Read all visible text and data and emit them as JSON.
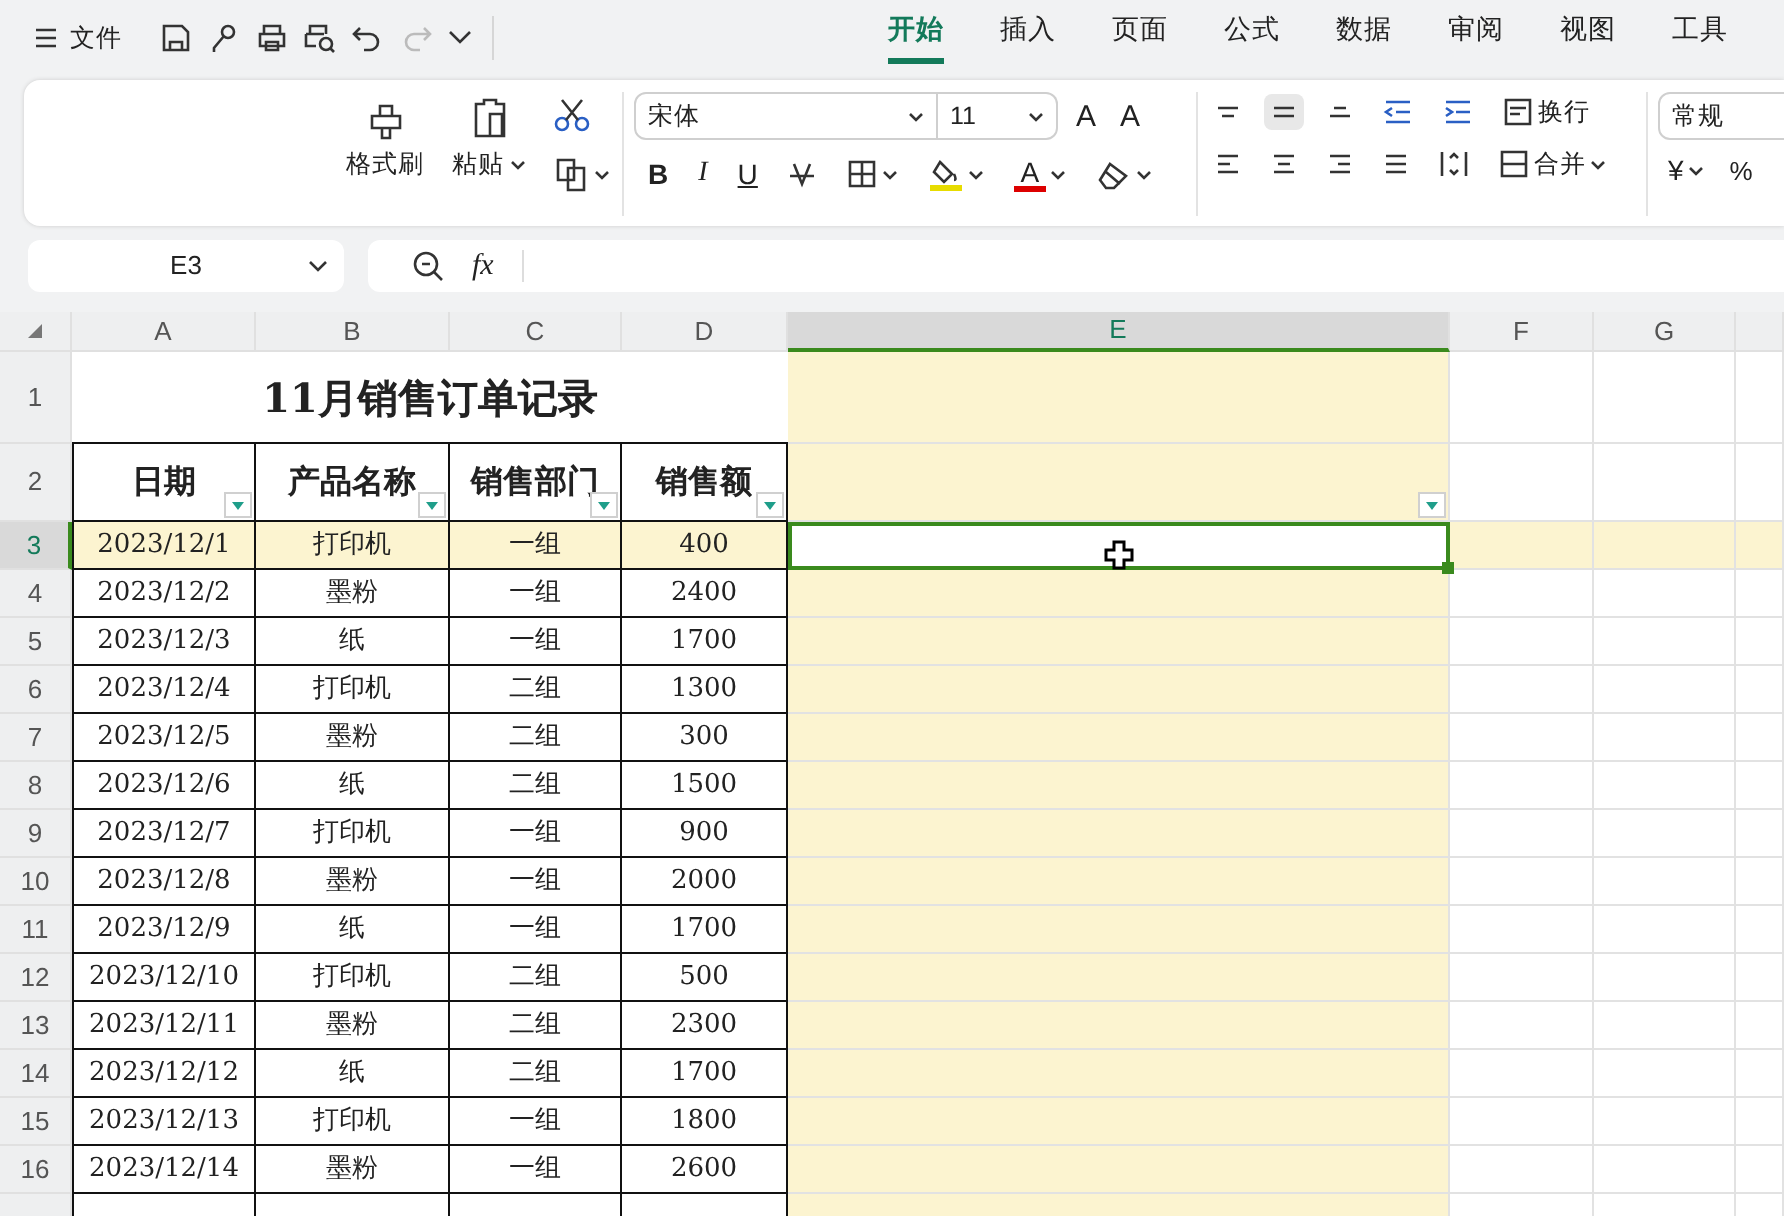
{
  "menu_bar": {
    "file_label": "文件",
    "tabs": [
      {
        "label": "开始",
        "selected": true
      },
      {
        "label": "插入",
        "selected": false
      },
      {
        "label": "页面",
        "selected": false
      },
      {
        "label": "公式",
        "selected": false
      },
      {
        "label": "数据",
        "selected": false
      },
      {
        "label": "审阅",
        "selected": false
      },
      {
        "label": "视图",
        "selected": false
      },
      {
        "label": "工具",
        "selected": false
      }
    ]
  },
  "ribbon": {
    "format_painter": "格式刷",
    "paste": "粘贴",
    "font": "宋体",
    "font_size": "11",
    "grow_font": "A",
    "shrink_font": "A",
    "bold": "B",
    "italic": "I",
    "underline": "U",
    "font_color": "A",
    "vertical_align": [
      {
        "selected": false
      },
      {
        "selected": true
      },
      {
        "selected": false
      }
    ],
    "horizontal_align": [
      {
        "selected": false
      },
      {
        "selected": false
      },
      {
        "selected": false
      },
      {
        "selected": false
      }
    ],
    "wrap": "换行",
    "merge": "合并",
    "number_format": "常规",
    "currency": "¥",
    "percent": "%"
  },
  "formula_bar": {
    "cell_ref": "E3",
    "function_label": "fx"
  },
  "sheet": {
    "columns": [
      {
        "label": "A",
        "selected": false
      },
      {
        "label": "B",
        "selected": false
      },
      {
        "label": "C",
        "selected": false
      },
      {
        "label": "D",
        "selected": false
      },
      {
        "label": "E",
        "selected": true
      },
      {
        "label": "F",
        "selected": false
      },
      {
        "label": "G",
        "selected": false
      }
    ],
    "rows": [
      {
        "label": "1",
        "selected": false
      },
      {
        "label": "2",
        "selected": false
      },
      {
        "label": "3",
        "selected": true
      },
      {
        "label": "4",
        "selected": false
      },
      {
        "label": "5",
        "selected": false
      },
      {
        "label": "6",
        "selected": false
      },
      {
        "label": "7",
        "selected": false
      },
      {
        "label": "8",
        "selected": false
      },
      {
        "label": "9",
        "selected": false
      },
      {
        "label": "10",
        "selected": false
      },
      {
        "label": "11",
        "selected": false
      },
      {
        "label": "12",
        "selected": false
      },
      {
        "label": "13",
        "selected": false
      },
      {
        "label": "14",
        "selected": false
      },
      {
        "label": "15",
        "selected": false
      },
      {
        "label": "16",
        "selected": false
      }
    ],
    "title": "11月销售订单记录",
    "headers": [
      "日期",
      "产品名称",
      "销售部门",
      "销售额"
    ],
    "records": [
      [
        "2023/12/1",
        "打印机",
        "一组",
        "400"
      ],
      [
        "2023/12/2",
        "墨粉",
        "一组",
        "2400"
      ],
      [
        "2023/12/3",
        "纸",
        "一组",
        "1700"
      ],
      [
        "2023/12/4",
        "打印机",
        "二组",
        "1300"
      ],
      [
        "2023/12/5",
        "墨粉",
        "二组",
        "300"
      ],
      [
        "2023/12/6",
        "纸",
        "二组",
        "1500"
      ],
      [
        "2023/12/7",
        "打印机",
        "一组",
        "900"
      ],
      [
        "2023/12/8",
        "墨粉",
        "一组",
        "2000"
      ],
      [
        "2023/12/9",
        "纸",
        "一组",
        "1700"
      ],
      [
        "2023/12/10",
        "打印机",
        "二组",
        "500"
      ],
      [
        "2023/12/11",
        "墨粉",
        "二组",
        "2300"
      ],
      [
        "2023/12/12",
        "纸",
        "二组",
        "1700"
      ],
      [
        "2023/12/13",
        "打印机",
        "一组",
        "1800"
      ],
      [
        "2023/12/14",
        "墨粉",
        "一组",
        "2600"
      ]
    ]
  }
}
